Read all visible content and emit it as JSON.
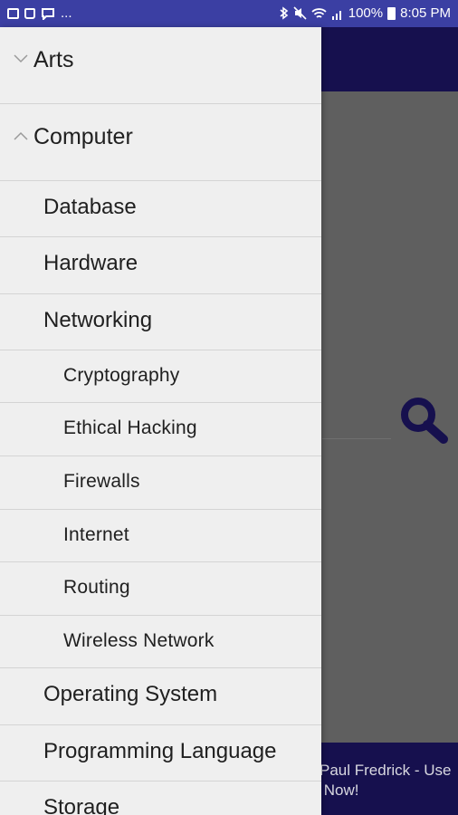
{
  "status_bar": {
    "ellipsis": "...",
    "battery": "100%",
    "time": "8:05 PM",
    "left_icons": [
      "gallery-icon",
      "bag-icon",
      "chat-icon"
    ],
    "right_icons": [
      "bluetooth-icon",
      "mute-icon",
      "wifi-icon",
      "signal-icon",
      "battery-icon"
    ],
    "color": "#3b3fa3"
  },
  "app": {
    "header_color": "#16104e",
    "search_icon": "search-icon",
    "footer_text": "Paul Fredrick - Use\n Now!"
  },
  "drawer": {
    "categories": [
      {
        "label": "Arts",
        "expanded": false,
        "icon": "chevron-down-icon"
      },
      {
        "label": "Computer",
        "expanded": true,
        "icon": "chevron-up-icon"
      }
    ],
    "computer_items": [
      {
        "label": "Database"
      },
      {
        "label": "Hardware"
      },
      {
        "label": "Networking"
      }
    ],
    "networking_items": [
      {
        "label": "Cryptography"
      },
      {
        "label": "Ethical Hacking"
      },
      {
        "label": "Firewalls"
      },
      {
        "label": "Internet"
      },
      {
        "label": "Routing"
      },
      {
        "label": "Wireless Network"
      }
    ],
    "more_computer_items": [
      {
        "label": "Operating System"
      },
      {
        "label": "Programming Language"
      },
      {
        "label": "Storage"
      }
    ]
  }
}
